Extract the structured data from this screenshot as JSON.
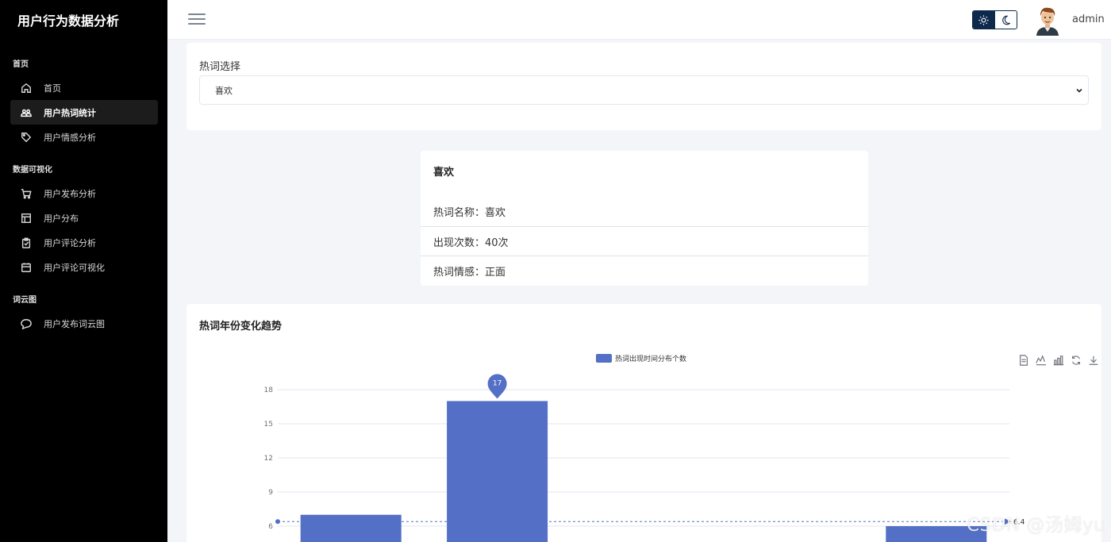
{
  "app": {
    "title": "用户行为数据分析"
  },
  "sidebar": {
    "sections": [
      {
        "label": "首页",
        "items": [
          {
            "label": "首页",
            "icon": "home-icon",
            "active": false
          },
          {
            "label": "用户热词统计",
            "icon": "users-icon",
            "active": true
          },
          {
            "label": "用户情感分析",
            "icon": "tag-icon",
            "active": false
          }
        ]
      },
      {
        "label": "数据可视化",
        "items": [
          {
            "label": "用户发布分析",
            "icon": "cart-icon",
            "active": false
          },
          {
            "label": "用户分布",
            "icon": "table-icon",
            "active": false
          },
          {
            "label": "用户评论分析",
            "icon": "clipboard-icon",
            "active": false
          },
          {
            "label": "用户评论可视化",
            "icon": "calendar-icon",
            "active": false
          }
        ]
      },
      {
        "label": "词云图",
        "items": [
          {
            "label": "用户发布词云图",
            "icon": "chat-icon",
            "active": false
          }
        ]
      }
    ]
  },
  "header": {
    "username": "admin",
    "theme": "light"
  },
  "hotword_select": {
    "label": "热词选择",
    "selected": "喜欢"
  },
  "info": {
    "title": "喜欢",
    "rows": [
      "热词名称：喜欢",
      "出现次数：40次",
      "热词情感：正面"
    ]
  },
  "chart": {
    "title": "热词年份变化趋势",
    "legend": "热词出现时间分布个数",
    "toolbox": [
      "data-view-icon",
      "line-switch-icon",
      "bar-switch-icon",
      "restore-icon",
      "download-icon"
    ]
  },
  "chart_data": {
    "type": "bar",
    "series": [
      {
        "name": "热词出现时间分布个数",
        "values": [
          7,
          17,
          null,
          null,
          6
        ]
      }
    ],
    "categories": [
      "",
      "",
      "",
      "",
      ""
    ],
    "yticks": [
      6,
      9,
      12,
      15,
      18
    ],
    "ylim": [
      0,
      21
    ],
    "markPoint": {
      "label": "17"
    },
    "markLine": {
      "label": "6.4",
      "value": 6.4
    },
    "grid": true,
    "color": "#5470c6"
  },
  "watermark": "CSDN @汤姆yu"
}
